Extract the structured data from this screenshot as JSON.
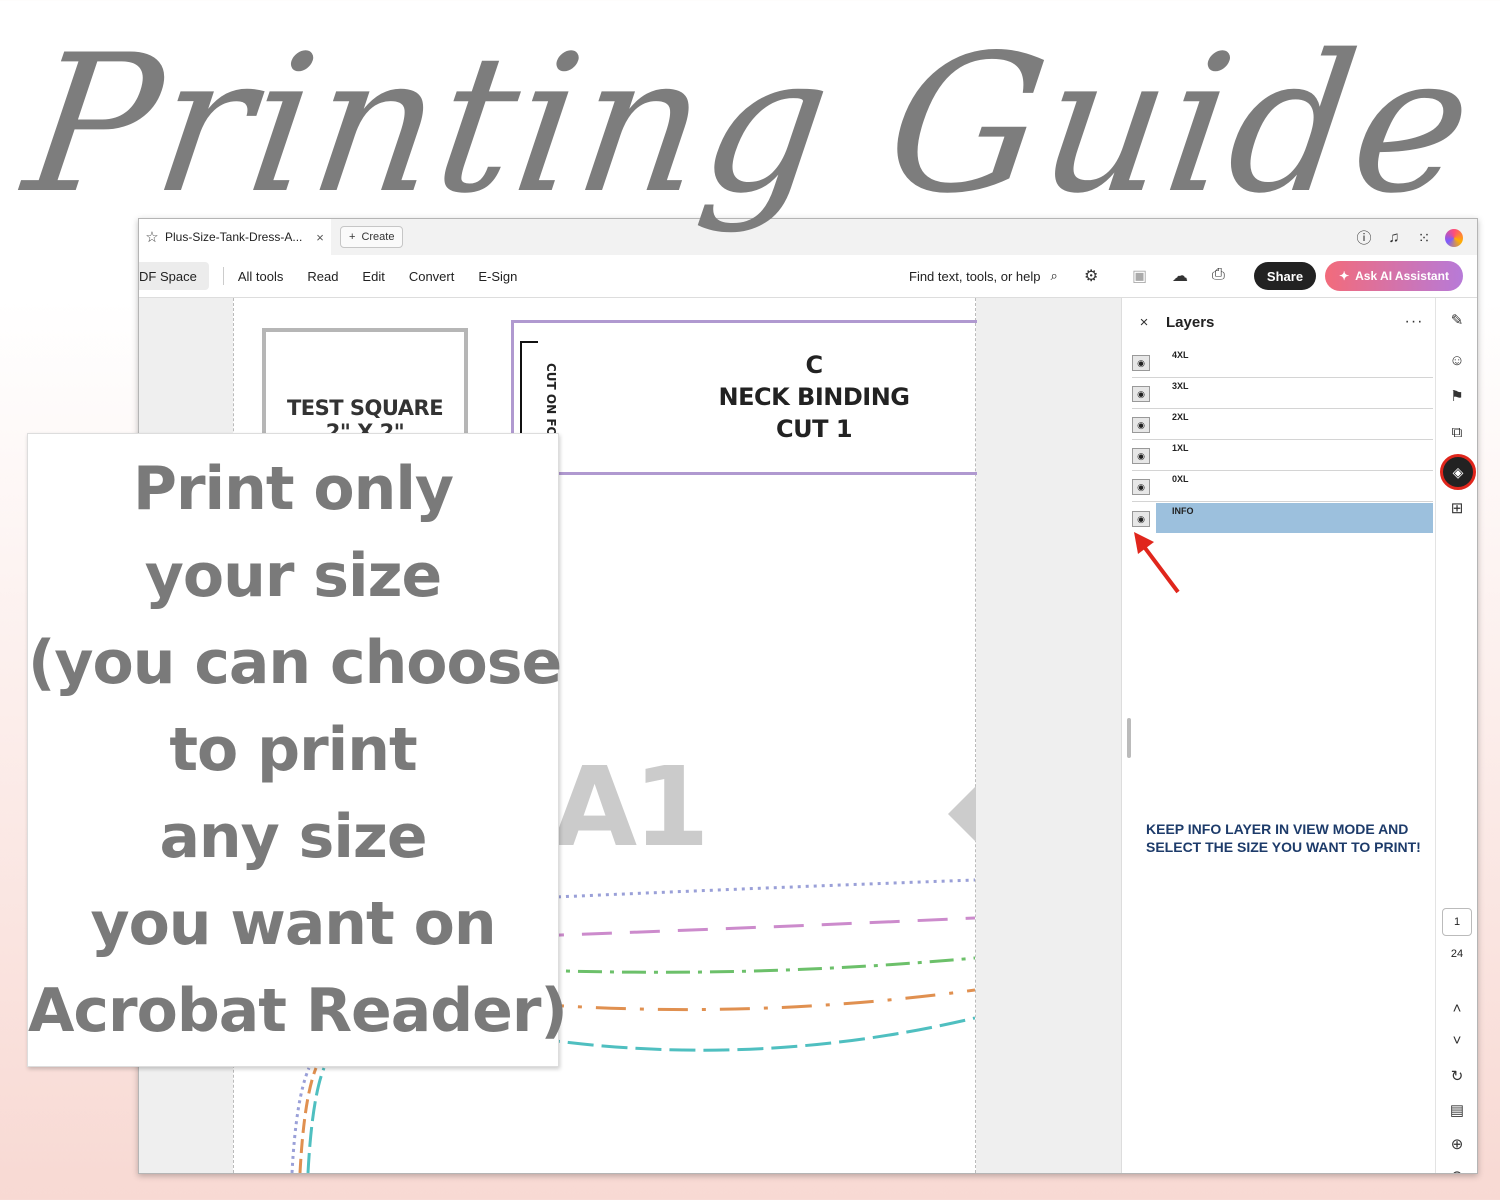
{
  "headline": "Printing Guide",
  "window": {
    "tab_title": "Plus-Size-Tank-Dress-A...",
    "tab_close": "×",
    "create_label": "Create",
    "pdf_space_label": "DF Space",
    "menu": [
      "All tools",
      "Read",
      "Edit",
      "Convert",
      "E-Sign"
    ],
    "search_label": "Find text, tools, or help",
    "share_label": "Share",
    "ai_label": "Ask AI Assistant"
  },
  "document": {
    "test_square": "TEST SQUARE",
    "test_square_size": "2\" X 2\"",
    "piece_lines": [
      "C",
      "NECK BINDING",
      "CUT 1"
    ],
    "cut_on_fold": "CUT ON FOLD",
    "big_piece_label": "A1"
  },
  "layers": {
    "title": "Layers",
    "close": "×",
    "more": "···",
    "items": [
      {
        "name": "4XL",
        "selected": false
      },
      {
        "name": "3XL",
        "selected": false
      },
      {
        "name": "2XL",
        "selected": false
      },
      {
        "name": "1XL",
        "selected": false
      },
      {
        "name": "0XL",
        "selected": false
      },
      {
        "name": "INFO",
        "selected": true
      }
    ],
    "annotation": "KEEP INFO LAYER IN VIEW MODE AND SELECT THE SIZE YOU WANT TO PRINT!"
  },
  "rail": {
    "current_page": "1",
    "total_pages": "24"
  },
  "callout": {
    "lines": [
      "Print only",
      "your size",
      "(you can choose",
      "to print",
      "any size",
      "you want on",
      "Acrobat Reader)"
    ]
  },
  "colors": {
    "accent_red": "#e0261c",
    "selected_layer": "#9cc0dd",
    "annotation_text": "#1d3b6a",
    "ai_gradient_start": "#f26b7b",
    "ai_gradient_end": "#b77ad8"
  }
}
